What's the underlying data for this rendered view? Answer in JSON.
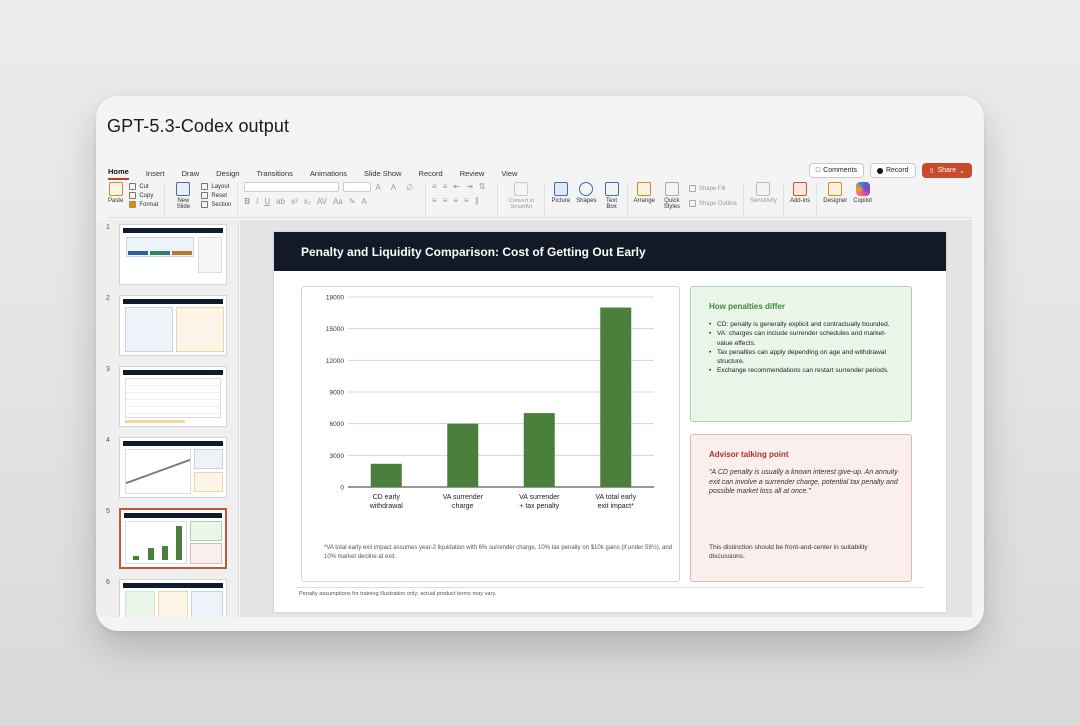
{
  "frame_title": "GPT-5.3-Codex output",
  "ribbon": {
    "tabs": [
      "Home",
      "Insert",
      "Draw",
      "Design",
      "Transitions",
      "Animations",
      "Slide Show",
      "Record",
      "Review",
      "View"
    ],
    "active_tab": "Home",
    "comments_label": "Comments",
    "record_label": "Record",
    "share_label": "Share"
  },
  "toolbar": {
    "paste": "Paste",
    "cut": "Cut",
    "copy": "Copy",
    "format": "Format",
    "new_slide": "New Slide",
    "layout": "Layout",
    "reset": "Reset",
    "section": "Section",
    "convert_smartart": "Convert to SmartArt",
    "picture": "Picture",
    "shapes": "Shapes",
    "text_box": "Text Box",
    "arrange": "Arrange",
    "quick_styles": "Quick Styles",
    "shape_fill": "Shape Fill",
    "shape_outline": "Shape Outline",
    "sensitivity": "Sensitivity",
    "add_ins": "Add-ins",
    "designer": "Designer",
    "copilot": "Copilot"
  },
  "thumbnails": {
    "numbers": [
      "1",
      "2",
      "3",
      "4",
      "5",
      "6"
    ],
    "selected": "5"
  },
  "slide": {
    "title": "Penalty and Liquidity Comparison: Cost of Getting Out Early",
    "footnote": "*VA total early exit impact assumes year-2 liquidation with 6% surrender charge, 10% tax penalty on $10k gains (if under 59½), and 10% market decline at exit.",
    "footer": "Penalty assumptions for training illustration only; actual product terms may vary.",
    "green_card": {
      "title": "How penalties differ",
      "bullets": [
        "CD: penalty is generally explicit and contractually bounded.",
        "VA: charges can include surrender schedules and market-value effects.",
        "Tax penalties can apply depending on age and withdrawal structure.",
        "Exchange recommendations can restart surrender periods."
      ]
    },
    "red_card": {
      "title": "Advisor talking point",
      "quote": "\"A CD penalty is usually a known interest give-up. An annuity exit can involve a surrender charge, potential tax penalty and possible market loss all at once.\"",
      "footer": "This distinction should be front-and-center in suitability discussions."
    }
  },
  "chart_data": {
    "type": "bar",
    "categories": [
      [
        "CD early",
        "withdrawal"
      ],
      [
        "VA surrender",
        "charge"
      ],
      [
        "VA surrender",
        "+ tax penalty"
      ],
      [
        "VA total early",
        "exit impact*"
      ]
    ],
    "values": [
      2200,
      6000,
      7000,
      17000
    ],
    "yticks": [
      0,
      3000,
      6000,
      9000,
      12000,
      15000,
      18000
    ],
    "ylim": [
      0,
      18000
    ],
    "color": "#4a7f3c",
    "grid": true
  }
}
